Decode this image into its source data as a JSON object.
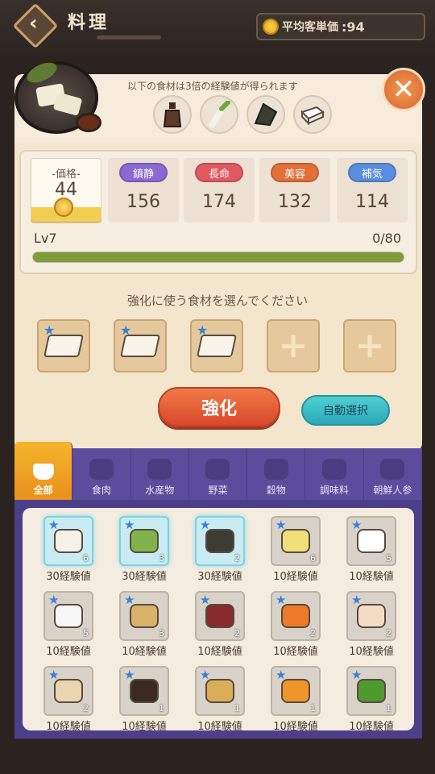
{
  "header": {
    "title": "料理",
    "avg_label": "平均客単価",
    "avg_value": ":94"
  },
  "bonus": {
    "text": "以下の食材は3倍の経験値が得られます",
    "items": [
      {
        "icon": "sauce-bottle-icon"
      },
      {
        "icon": "green-onion-icon"
      },
      {
        "icon": "seaweed-icon"
      },
      {
        "icon": "tofu-icon"
      }
    ]
  },
  "stats": {
    "price_label": "-価格-",
    "price_value": "44",
    "attributes": [
      {
        "label": "鎮静",
        "value": "156",
        "color": "#8a6ad2"
      },
      {
        "label": "長命",
        "value": "174",
        "color": "#e05a62"
      },
      {
        "label": "美容",
        "value": "132",
        "color": "#e2703a"
      },
      {
        "label": "補気",
        "value": "114",
        "color": "#5a8ee0"
      }
    ],
    "level": "Lv7",
    "exp": "0/80",
    "exp_progress": 1.0
  },
  "enhance": {
    "prompt": "強化に使う食材を選んでください",
    "button": "強化",
    "auto_button": "自動選択",
    "slots": [
      "tofu",
      "tofu",
      "tofu",
      "empty",
      "empty"
    ]
  },
  "tabs": [
    {
      "label": "全部",
      "icon": "basket-icon",
      "active": true
    },
    {
      "label": "食肉",
      "icon": "meat-icon"
    },
    {
      "label": "水産物",
      "icon": "fish-icon"
    },
    {
      "label": "野菜",
      "icon": "vegetable-icon"
    },
    {
      "label": "穀物",
      "icon": "grain-icon"
    },
    {
      "label": "調味料",
      "icon": "seasoning-icon"
    },
    {
      "label": "朝鮮人参",
      "icon": "ginseng-icon"
    }
  ],
  "inventory": [
    {
      "name": "tofu",
      "count": "6",
      "exp": "30経験値",
      "highlight": true,
      "color": "#f5f1e6"
    },
    {
      "name": "green-onion",
      "count": "3",
      "exp": "30経験値",
      "highlight": true,
      "color": "#7fb34a"
    },
    {
      "name": "seaweed",
      "count": "2",
      "exp": "30経験値",
      "highlight": true,
      "color": "#3b3d32"
    },
    {
      "name": "garlic",
      "count": "6",
      "exp": "10経験値",
      "highlight": false,
      "color": "#f1e07a"
    },
    {
      "name": "salt",
      "count": "5",
      "exp": "10経験値",
      "highlight": false,
      "color": "#ffffff"
    },
    {
      "name": "flour",
      "count": "5",
      "exp": "10経験値",
      "highlight": false,
      "color": "#f7f7f7"
    },
    {
      "name": "miso",
      "count": "3",
      "exp": "10経験値",
      "highlight": false,
      "color": "#d9b26a"
    },
    {
      "name": "red-beans",
      "count": "2",
      "exp": "10経験値",
      "highlight": false,
      "color": "#8a2b2b"
    },
    {
      "name": "carrot",
      "count": "2",
      "exp": "10経験値",
      "highlight": false,
      "color": "#ef7a2a"
    },
    {
      "name": "eggs",
      "count": "2",
      "exp": "10経験値",
      "highlight": false,
      "color": "#f3dcc6"
    },
    {
      "name": "breadcrumbs",
      "count": "2",
      "exp": "10経験値",
      "highlight": false,
      "color": "#e8d6b0"
    },
    {
      "name": "soy-sauce",
      "count": "1",
      "exp": "10経験値",
      "highlight": false,
      "color": "#3a2a22"
    },
    {
      "name": "ginger",
      "count": "1",
      "exp": "10経験値",
      "highlight": false,
      "color": "#d9ad5a"
    },
    {
      "name": "pumpkin",
      "count": "1",
      "exp": "10経験値",
      "highlight": false,
      "color": "#f0952a"
    },
    {
      "name": "green-beans",
      "count": "1",
      "exp": "10経験値",
      "highlight": false,
      "color": "#4f9a2f"
    }
  ]
}
